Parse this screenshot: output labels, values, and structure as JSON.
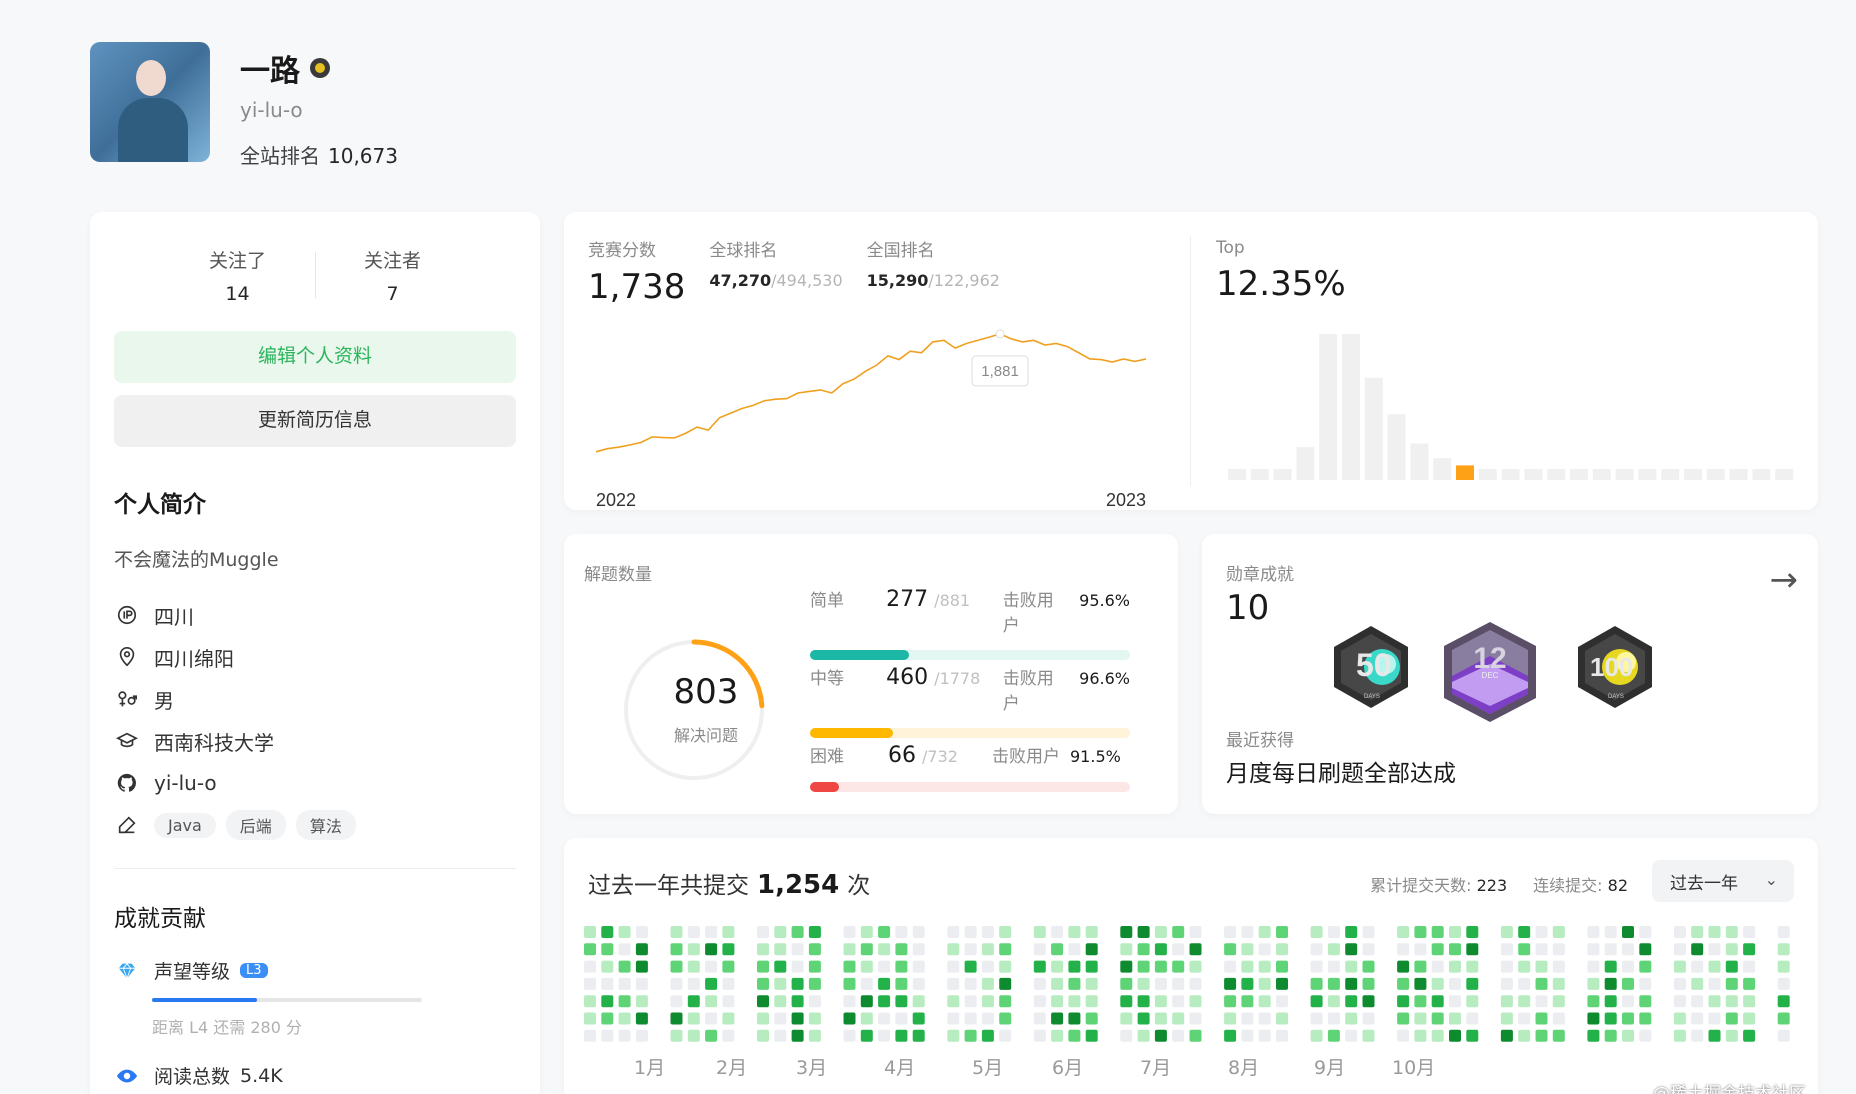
{
  "profile": {
    "name": "一路",
    "username": "yi-lu-o",
    "rank_label": "全站排名",
    "rank_value": "10,673"
  },
  "follow": {
    "following_label": "关注了",
    "following_count": "14",
    "followers_label": "关注者",
    "followers_count": "7"
  },
  "buttons": {
    "edit_profile": "编辑个人资料",
    "update_resume": "更新简历信息"
  },
  "intro": {
    "title": "个人简介",
    "bio": "不会魔法的Muggle",
    "ip": "四川",
    "location": "四川绵阳",
    "gender": "男",
    "school": "西南科技大学",
    "github": "yi-lu-o",
    "tags": [
      "Java",
      "后端",
      "算法"
    ]
  },
  "contribution": {
    "title": "成就贡献",
    "reputation_label": "声望等级",
    "level": "L3",
    "level_progress": 0.39,
    "progress_note": "距离 L4 还需 280 分",
    "reads_label": "阅读总数",
    "reads_value": "5.4K"
  },
  "contest": {
    "score_label": "竞赛分数",
    "score": "1,738",
    "global_label": "全球排名",
    "global_rank": "47,270",
    "global_total": "/494,530",
    "national_label": "全国排名",
    "national_rank": "15,290",
    "national_total": "/122,962",
    "top_label": "Top",
    "top_value": "12.35%",
    "tooltip": "1,881",
    "year_start": "2022",
    "year_end": "2023"
  },
  "chart_data": {
    "type": "line",
    "x": [
      0,
      1,
      2,
      3,
      4,
      5,
      6,
      7,
      8,
      9,
      10,
      11,
      12,
      13,
      14,
      15,
      16,
      17,
      18,
      19,
      20,
      21,
      22,
      23,
      24,
      25,
      26,
      27,
      28,
      29,
      30,
      31,
      32,
      33,
      34,
      35,
      36,
      37,
      38,
      39,
      40,
      41,
      42,
      43,
      44,
      45,
      46,
      47,
      48,
      49
    ],
    "y": [
      1500,
      1510,
      1515,
      1522,
      1530,
      1548,
      1546,
      1545,
      1560,
      1580,
      1570,
      1610,
      1625,
      1640,
      1650,
      1665,
      1670,
      1672,
      1690,
      1695,
      1700,
      1690,
      1720,
      1735,
      1760,
      1780,
      1810,
      1798,
      1825,
      1820,
      1855,
      1860,
      1835,
      1850,
      1860,
      1870,
      1881,
      1865,
      1855,
      1860,
      1845,
      1850,
      1840,
      1820,
      1800,
      1798,
      1790,
      1800,
      1792,
      1800
    ],
    "tick_labels": [
      "2022",
      "2023"
    ],
    "annotation": "1,881",
    "color": "#f0a020"
  },
  "distribution": {
    "type": "bar",
    "values": [
      3,
      3,
      3,
      9,
      40,
      40,
      28,
      18,
      10,
      6,
      4,
      3,
      3,
      3,
      3,
      3,
      3,
      3,
      3,
      3,
      3,
      3,
      3,
      3,
      3
    ],
    "highlight_index": 10
  },
  "solved": {
    "label": "解题数量",
    "total": "803",
    "total_label": "解决问题",
    "ring_fraction": 0.24,
    "rows": [
      {
        "name": "简单",
        "count": "277",
        "total": "/881",
        "beat_label": "击败用户",
        "beat": "95.6%",
        "fraction": 0.31,
        "color": "#1cb8a5",
        "track": "#e3f6f2"
      },
      {
        "name": "中等",
        "count": "460",
        "total": "/1778",
        "beat_label": "击败用户",
        "beat": "96.6%",
        "fraction": 0.26,
        "color": "#ffb800",
        "track": "#fff3d9"
      },
      {
        "name": "困难",
        "count": "66",
        "total": "/732",
        "beat_label": "击败用户",
        "beat": "91.5%",
        "fraction": 0.09,
        "color": "#ef4743",
        "track": "#fde6e6"
      }
    ]
  },
  "medals": {
    "label": "勋章成就",
    "count": "10",
    "recent_label": "最近获得",
    "recent_value": "月度每日刷题全部达成",
    "items": [
      {
        "name": "50-days-medal",
        "text": "50",
        "sub": "DAYS"
      },
      {
        "name": "dec-12-medal",
        "text": "12",
        "sub": "DEC"
      },
      {
        "name": "100-days-medal",
        "text": "100",
        "sub": "DAYS"
      }
    ]
  },
  "heatmap": {
    "title_prefix": "过去一年共提交",
    "count": "1,254",
    "title_suffix": "次",
    "days_label": "累计提交天数:",
    "days_value": "223",
    "streak_label": "连续提交:",
    "streak_value": "82",
    "range": "过去一年",
    "months": [
      "1月",
      "2月",
      "3月",
      "4月",
      "5月",
      "6月",
      "7月",
      "8月",
      "9月",
      "10月"
    ],
    "levels": [
      "#ebedf0",
      "#b7ebc0",
      "#5fd477",
      "#23b24a",
      "#0e8a2f"
    ]
  },
  "watermark": "@稀土掘金技术社区"
}
